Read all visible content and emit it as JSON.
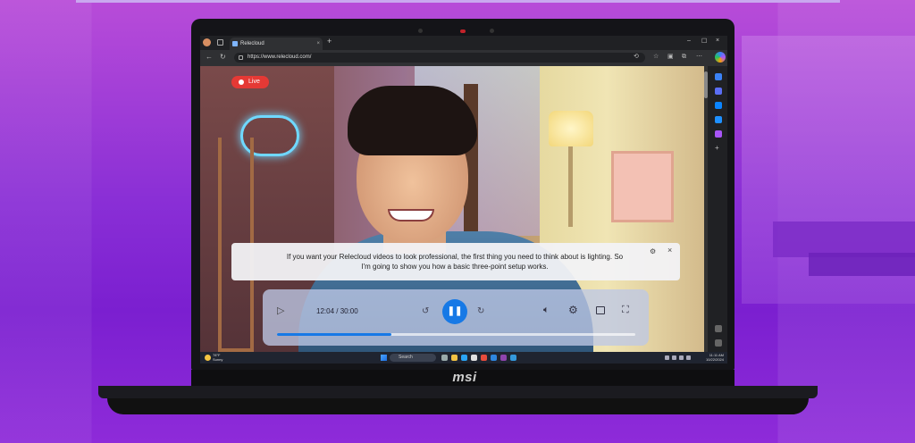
{
  "browser": {
    "tab_title": "Relecloud",
    "tab_close": "×",
    "new_tab": "+",
    "address": "https://www.relecloud.com/",
    "window_controls": [
      "–",
      "☐",
      "×"
    ]
  },
  "video": {
    "live_label": "Live",
    "caption": "If you want your Relecloud videos to look professional, the first thing you need to think about is lighting. So I'm going to show you how a basic three-point setup works.",
    "time": "12:04 / 30:00",
    "progress_fraction": 0.32
  },
  "taskbar": {
    "search_placeholder": "Search",
    "weather_temp": "78°F",
    "weather_desc": "Sunny",
    "time": "11:11 AM",
    "date": "10/22/2024"
  },
  "brand": {
    "logo": "msi"
  },
  "icons": {
    "cap_settings": "gear-icon",
    "cap_close": "close-icon",
    "play": "play-icon",
    "pause": "pause-icon",
    "volume": "volume-icon",
    "fullscreen": "fullscreen-icon"
  },
  "colors": {
    "accent": "#1779e6",
    "live": "#e53935",
    "background": "#8a2fd6"
  }
}
